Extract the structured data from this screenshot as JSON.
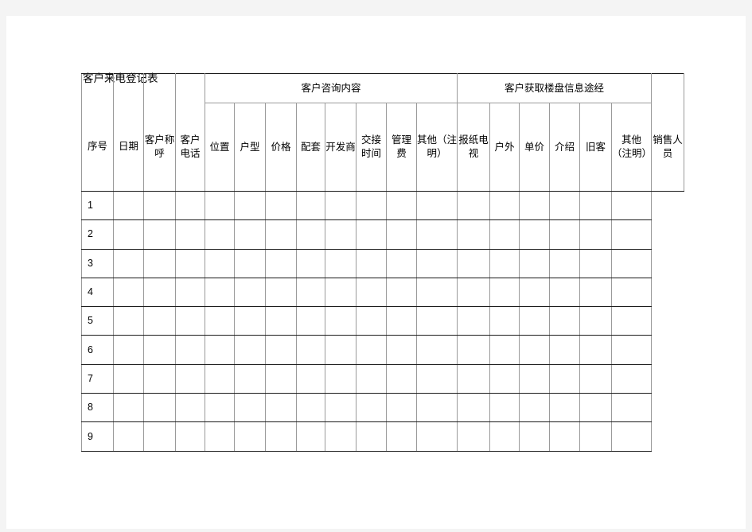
{
  "document": {
    "title": "客户来电登记表"
  },
  "table": {
    "simple_headers": {
      "seq": "序号",
      "date": "日期",
      "customer_name": "客户称呼",
      "customer_phone": "客户电话",
      "salesperson": "销售人员"
    },
    "groups": [
      {
        "label": "客户咨询内容",
        "columns": [
          "位置",
          "户型",
          "价格",
          "配套",
          "开发商",
          "交接时间",
          "管理费",
          "其他（注明）"
        ]
      },
      {
        "label": "客户获取楼盘信息途经",
        "columns": [
          "报纸电视",
          "户外",
          "单价",
          "介绍",
          "旧客",
          "其他（注明）"
        ]
      }
    ],
    "rows": [
      {
        "seq": "1"
      },
      {
        "seq": "2"
      },
      {
        "seq": "3"
      },
      {
        "seq": "4"
      },
      {
        "seq": "5"
      },
      {
        "seq": "6"
      },
      {
        "seq": "7"
      },
      {
        "seq": "8"
      },
      {
        "seq": "9"
      }
    ]
  },
  "colors": {
    "page_background": "#ffffff",
    "canvas_background": "#f4f4f4",
    "horizontal_rule": "#1a1a1a",
    "vertical_rule": "#9a9a9a",
    "text": "#000000"
  }
}
